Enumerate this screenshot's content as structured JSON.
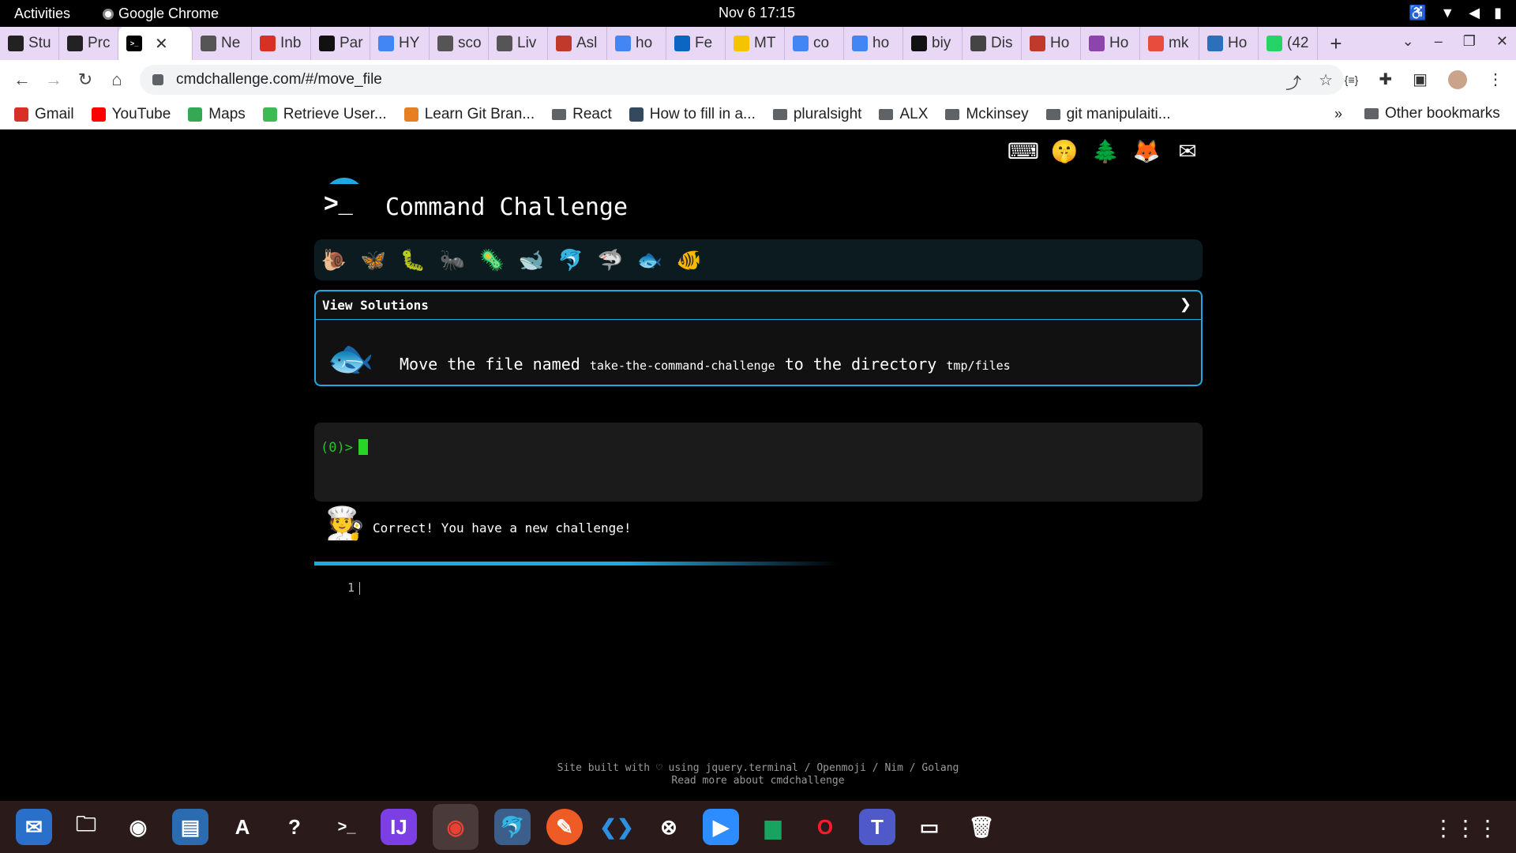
{
  "topbar": {
    "activities": "Activities",
    "app_name": "Google Chrome",
    "clock": "Nov 6  17:15"
  },
  "tabs": [
    {
      "label": "Stu",
      "icon": "alx-icon",
      "color": "#222"
    },
    {
      "label": "Prc",
      "icon": "alx-icon",
      "color": "#222"
    },
    {
      "label": "",
      "icon": "terminal-icon",
      "color": "#000",
      "active": true
    },
    {
      "label": "Ne",
      "icon": "chrome-icon",
      "color": "#555"
    },
    {
      "label": "Inb",
      "icon": "gmail-icon",
      "color": "#d93025"
    },
    {
      "label": "Par",
      "icon": "pen-icon",
      "color": "#111"
    },
    {
      "label": "HY",
      "icon": "docs-icon",
      "color": "#4285f4"
    },
    {
      "label": "sco",
      "icon": "ball-icon",
      "color": "#555"
    },
    {
      "label": "Liv",
      "icon": "ball-icon",
      "color": "#555"
    },
    {
      "label": "Asl",
      "icon": "site-icon",
      "color": "#c0392b"
    },
    {
      "label": "ho",
      "icon": "google-icon",
      "color": "#4285f4"
    },
    {
      "label": "Fe",
      "icon": "linkedin-icon",
      "color": "#0a66c2"
    },
    {
      "label": "MT",
      "icon": "mtn-icon",
      "color": "#f5c400"
    },
    {
      "label": "co",
      "icon": "google-icon",
      "color": "#4285f4"
    },
    {
      "label": "ho",
      "icon": "google-icon",
      "color": "#4285f4"
    },
    {
      "label": "biy",
      "icon": "github-icon",
      "color": "#111"
    },
    {
      "label": "Dis",
      "icon": "bike-icon",
      "color": "#444"
    },
    {
      "label": "Ho",
      "icon": "layers-icon",
      "color": "#c0392b"
    },
    {
      "label": "Ho",
      "icon": "grid-icon",
      "color": "#8e44ad"
    },
    {
      "label": "mk",
      "icon": "flag-icon",
      "color": "#e74c3c"
    },
    {
      "label": "Ho",
      "icon": "globe-icon",
      "color": "#2c6fbb"
    },
    {
      "label": "(42",
      "icon": "whatsapp-icon",
      "color": "#25d366"
    }
  ],
  "toolbar": {
    "url": "cmdchallenge.com/#/move_file"
  },
  "bookmarks": [
    {
      "label": "Gmail",
      "type": "site",
      "color": "#d93025"
    },
    {
      "label": "YouTube",
      "type": "site",
      "color": "#ff0000"
    },
    {
      "label": "Maps",
      "type": "site",
      "color": "#34a853"
    },
    {
      "label": "Retrieve User...",
      "type": "site",
      "color": "#3cba54"
    },
    {
      "label": "Learn Git Bran...",
      "type": "site",
      "color": "#e67e22"
    },
    {
      "label": "React",
      "type": "folder"
    },
    {
      "label": "How to fill in a...",
      "type": "site",
      "color": "#34495e"
    },
    {
      "label": "pluralsight",
      "type": "folder"
    },
    {
      "label": "ALX",
      "type": "folder"
    },
    {
      "label": "Mckinsey",
      "type": "folder"
    },
    {
      "label": "git manipulaiti...",
      "type": "folder"
    }
  ],
  "bookmarks_more": "»",
  "bookmarks_other": "Other bookmarks",
  "page": {
    "title": "Command Challenge",
    "view_solutions": "View Solutions",
    "task_part1": "Move the file named",
    "task_file": "take-the-command-challenge",
    "task_part2": "to the directory",
    "task_dir": "tmp/files",
    "prompt": "(0)>",
    "feedback": "Correct! You have a new challenge!",
    "editor_line": "1",
    "footer_line1": "Site built with ♡ using jquery.terminal / Openmoji / Nim / Golang",
    "footer_line2": "Read more about cmdchallenge",
    "accent_color": "#1fa9e1",
    "prompt_color": "#27c227"
  },
  "level_icons": [
    "snail-icon",
    "butterfly-icon",
    "caterpillar-icon",
    "ant-icon",
    "microbe-icon",
    "whale-icon",
    "dolphin-icon",
    "shark-icon",
    "fish-icon",
    "tropical-fish-icon"
  ]
}
